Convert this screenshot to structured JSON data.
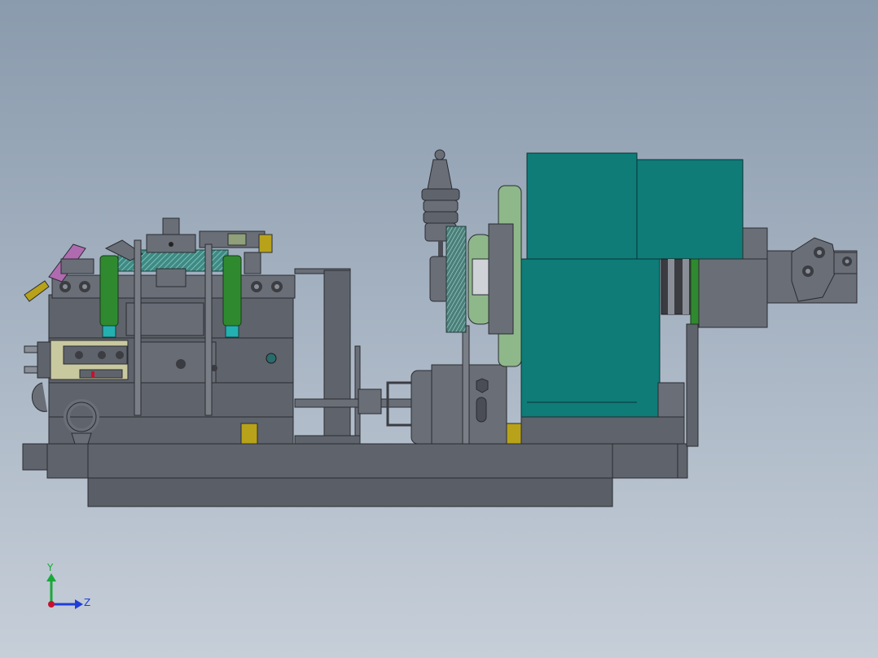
{
  "viewport": {
    "background_top": "#8a9bad",
    "background_bottom": "#c6ced8"
  },
  "triad": {
    "y_label": "Y",
    "z_label": "Z",
    "y_color": "#1aa83a",
    "z_color": "#1f3fd8",
    "origin_color": "#c8102e"
  },
  "model": {
    "colors": {
      "frame": "#5f636c",
      "frame_dark": "#4a4d55",
      "teal": "#0f7c78",
      "green": "#2f8a2f",
      "olive": "#b8a21a",
      "magenta": "#b06bb0",
      "cyan": "#23b0b0",
      "gear_green": "#8fb88a",
      "gear_teal": "#3f8a84"
    }
  }
}
